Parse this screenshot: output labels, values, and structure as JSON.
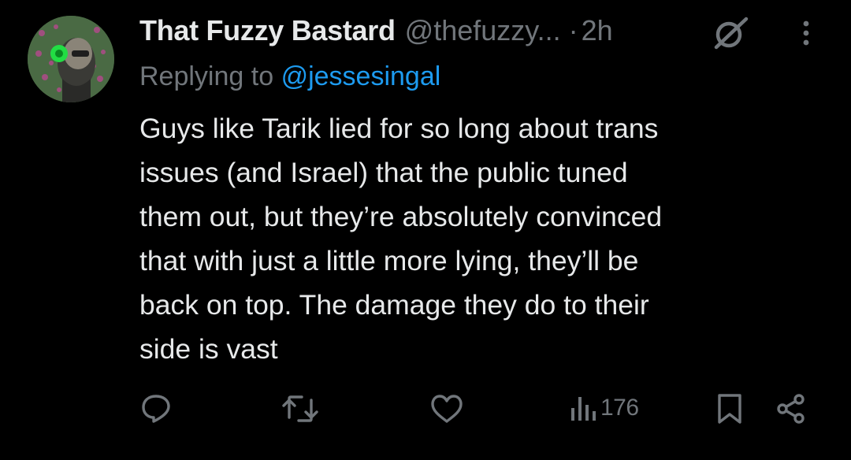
{
  "tweet": {
    "display_name": "That Fuzzy Bastard",
    "handle": "@thefuzzy...",
    "separator": "·",
    "time": "2h",
    "reply_prefix": "Replying to",
    "reply_to": "@jessesingal",
    "body_lines": [
      "Guys like Tarik lied for so long about trans",
      "issues (and Israel) that  the public tuned",
      "them out, but they’re absolutely convinced",
      "that with just a little more lying, they’ll be",
      "back on top. The damage they do to their",
      "side is vast"
    ]
  },
  "actions": {
    "views_count": "176"
  },
  "icons": {
    "avatar": "avatar",
    "grok": "grok-icon",
    "more": "more-options-icon",
    "reply": "reply-icon",
    "retweet": "retweet-icon",
    "like": "like-icon",
    "views": "views-icon",
    "bookmark": "bookmark-icon",
    "share": "share-icon"
  },
  "colors": {
    "background": "#000000",
    "primary_text": "#e7e9ea",
    "secondary_text": "#71767b",
    "link": "#1d9bf0"
  }
}
